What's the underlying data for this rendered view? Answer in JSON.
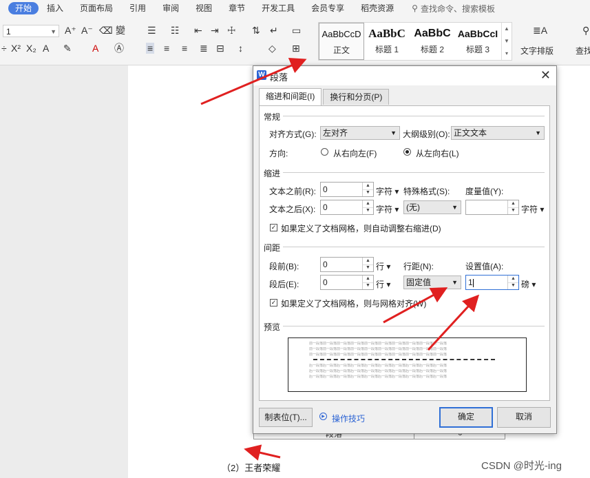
{
  "menu": {
    "tabs": [
      "开始",
      "插入",
      "页面布局",
      "引用",
      "审阅",
      "视图",
      "章节",
      "开发工具",
      "会员专享",
      "稻壳资源"
    ],
    "active_tab": "开始",
    "search_placeholder": "查找命令、搜索模板"
  },
  "ribbon": {
    "font_size": "1",
    "styles": [
      {
        "sample": "AaBbCcD",
        "name": "正文"
      },
      {
        "sample": "AaBbC",
        "name": "标题 1"
      },
      {
        "sample": "AaBbC",
        "name": "标题 2"
      },
      {
        "sample": "AaBbCcI",
        "name": "标题 3"
      }
    ],
    "text_layout_label": "文字排版",
    "find_label": "查找"
  },
  "document": {
    "table_fragment": {
      "left_cell": "段落",
      "right_cell": "0"
    },
    "caption": "（2）王者荣耀",
    "watermark": "CSDN @时光-ing"
  },
  "dialog": {
    "title": "段落",
    "tabs": [
      "缩进和间距(I)",
      "换行和分页(P)"
    ],
    "active_tab": "缩进和间距(I)",
    "general": {
      "section": "常规",
      "align_label": "对齐方式(G):",
      "align_value": "左对齐",
      "outline_label": "大纲级别(O):",
      "outline_value": "正文文本",
      "direction_label": "方向:",
      "rtl_label": "从右向左(F)",
      "ltr_label": "从左向右(L)",
      "direction_selected": "从左向右(L)"
    },
    "indent": {
      "section": "缩进",
      "before_label": "文本之前(R):",
      "before_value": "0",
      "before_unit": "字符",
      "after_label": "文本之后(X):",
      "after_value": "0",
      "after_unit": "字符",
      "special_label": "特殊格式(S):",
      "special_value": "(无)",
      "measure_label": "度量值(Y):",
      "measure_value": "",
      "measure_unit": "字符",
      "grid_check_label": "如果定义了文档网格，则自动调整右缩进(D)",
      "grid_checked": true
    },
    "spacing": {
      "section": "间距",
      "before_label": "段前(B):",
      "before_value": "0",
      "before_unit": "行",
      "after_label": "段后(E):",
      "after_value": "0",
      "after_unit": "行",
      "line_spacing_label": "行距(N):",
      "line_spacing_value": "固定值",
      "set_value_label": "设置值(A):",
      "set_value": "1",
      "set_value_unit": "磅",
      "grid_check_label": "如果定义了文档网格，则与网格对齐(W)",
      "grid_checked": true
    },
    "preview": {
      "section": "预览",
      "prev_text": "前一段落前一段落前一段落前一段落前一段落前一段落前一段落前一段落前一段落前一段落",
      "next_text": "后一段落后一段落后一段落后一段落后一段落后一段落后一段落后一段落后一段落后一段落"
    },
    "buttons": {
      "tabs_label": "制表位(T)...",
      "tips_label": "操作技巧",
      "ok_label": "确定",
      "cancel_label": "取消"
    }
  },
  "colors": {
    "accent": "#4a7ee0",
    "arrow": "#e02020",
    "link": "#2b63d4"
  }
}
